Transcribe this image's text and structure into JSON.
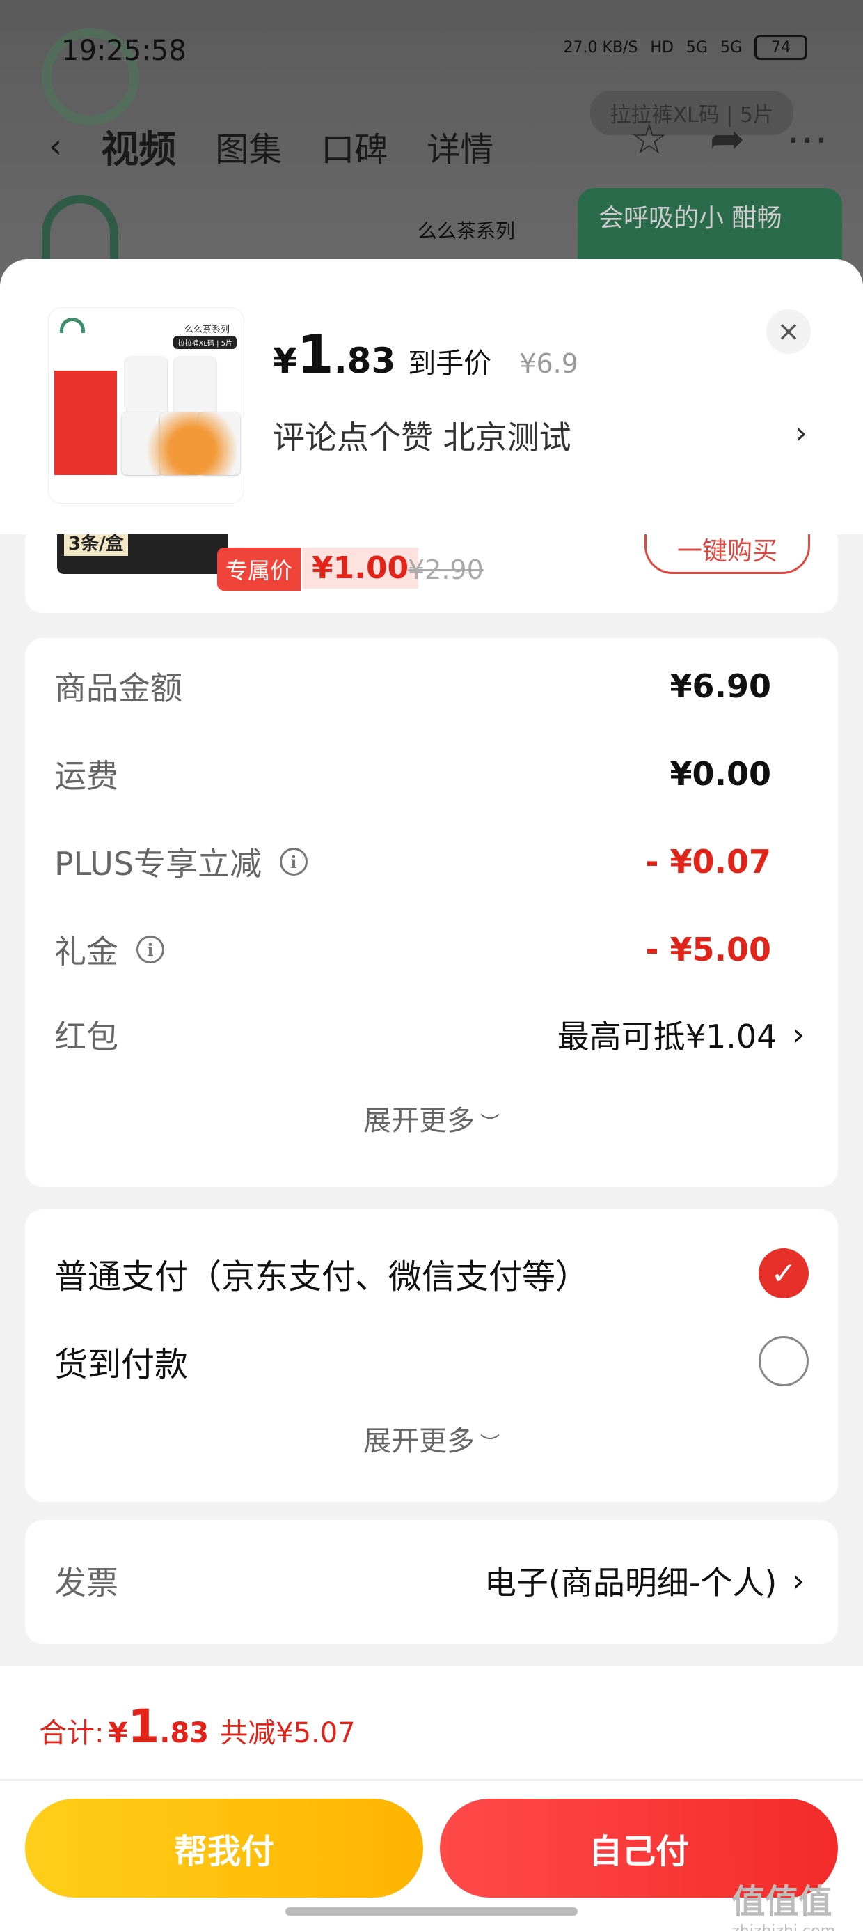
{
  "status_bar": {
    "time": "19:25:58",
    "net_speed": "27.0 KB/S",
    "hd": "HD",
    "sig1": "5G",
    "sig2": "5G",
    "battery": "74"
  },
  "background": {
    "tabs": [
      "视频",
      "图集",
      "口碑",
      "详情"
    ],
    "tag": "拉拉裤XL码 | 5片",
    "series": "么么茶系列",
    "promo": "会呼吸的小 酣畅"
  },
  "sheet": {
    "price_yen": "¥",
    "price_int": "1",
    "price_dec": ".83",
    "price_label": "到手价",
    "orig_price": "¥6.9",
    "subtitle": "评论点个赞  北京测试",
    "close": "×"
  },
  "offer": {
    "img_text": "3条/盒",
    "tag": "专属价",
    "price": "¥1.00",
    "old_price": "¥2.90",
    "buy_button": "一键购买"
  },
  "amounts": {
    "rows": [
      {
        "label": "商品金额",
        "value": "¥6.90"
      },
      {
        "label": "运费",
        "value": "¥0.00"
      },
      {
        "label": "PLUS专享立减",
        "value": "- ¥0.07"
      },
      {
        "label": "礼金",
        "value": "- ¥5.00"
      },
      {
        "label": "红包",
        "value": "最高可抵¥1.04"
      }
    ],
    "expand": "展开更多"
  },
  "payment": {
    "options": [
      {
        "label": "普通支付（京东支付、微信支付等）",
        "selected": true
      },
      {
        "label": "货到付款",
        "selected": false
      }
    ],
    "expand": "展开更多"
  },
  "invoice": {
    "label": "发票",
    "value": "电子(商品明细-个人)"
  },
  "footer": {
    "total_label": "合计:",
    "total_yen": "¥",
    "total_int": "1",
    "total_dec": ".83",
    "saved": "共减¥5.07",
    "help_pay": "帮我付",
    "self_pay": "自己付"
  },
  "watermark": {
    "main": "值值值",
    "sub": "zhizhizhi.com"
  },
  "colors": {
    "accent_red": "#e2231a",
    "help_yellow": "#ffbe0b",
    "self_red": "#f42a2a"
  }
}
